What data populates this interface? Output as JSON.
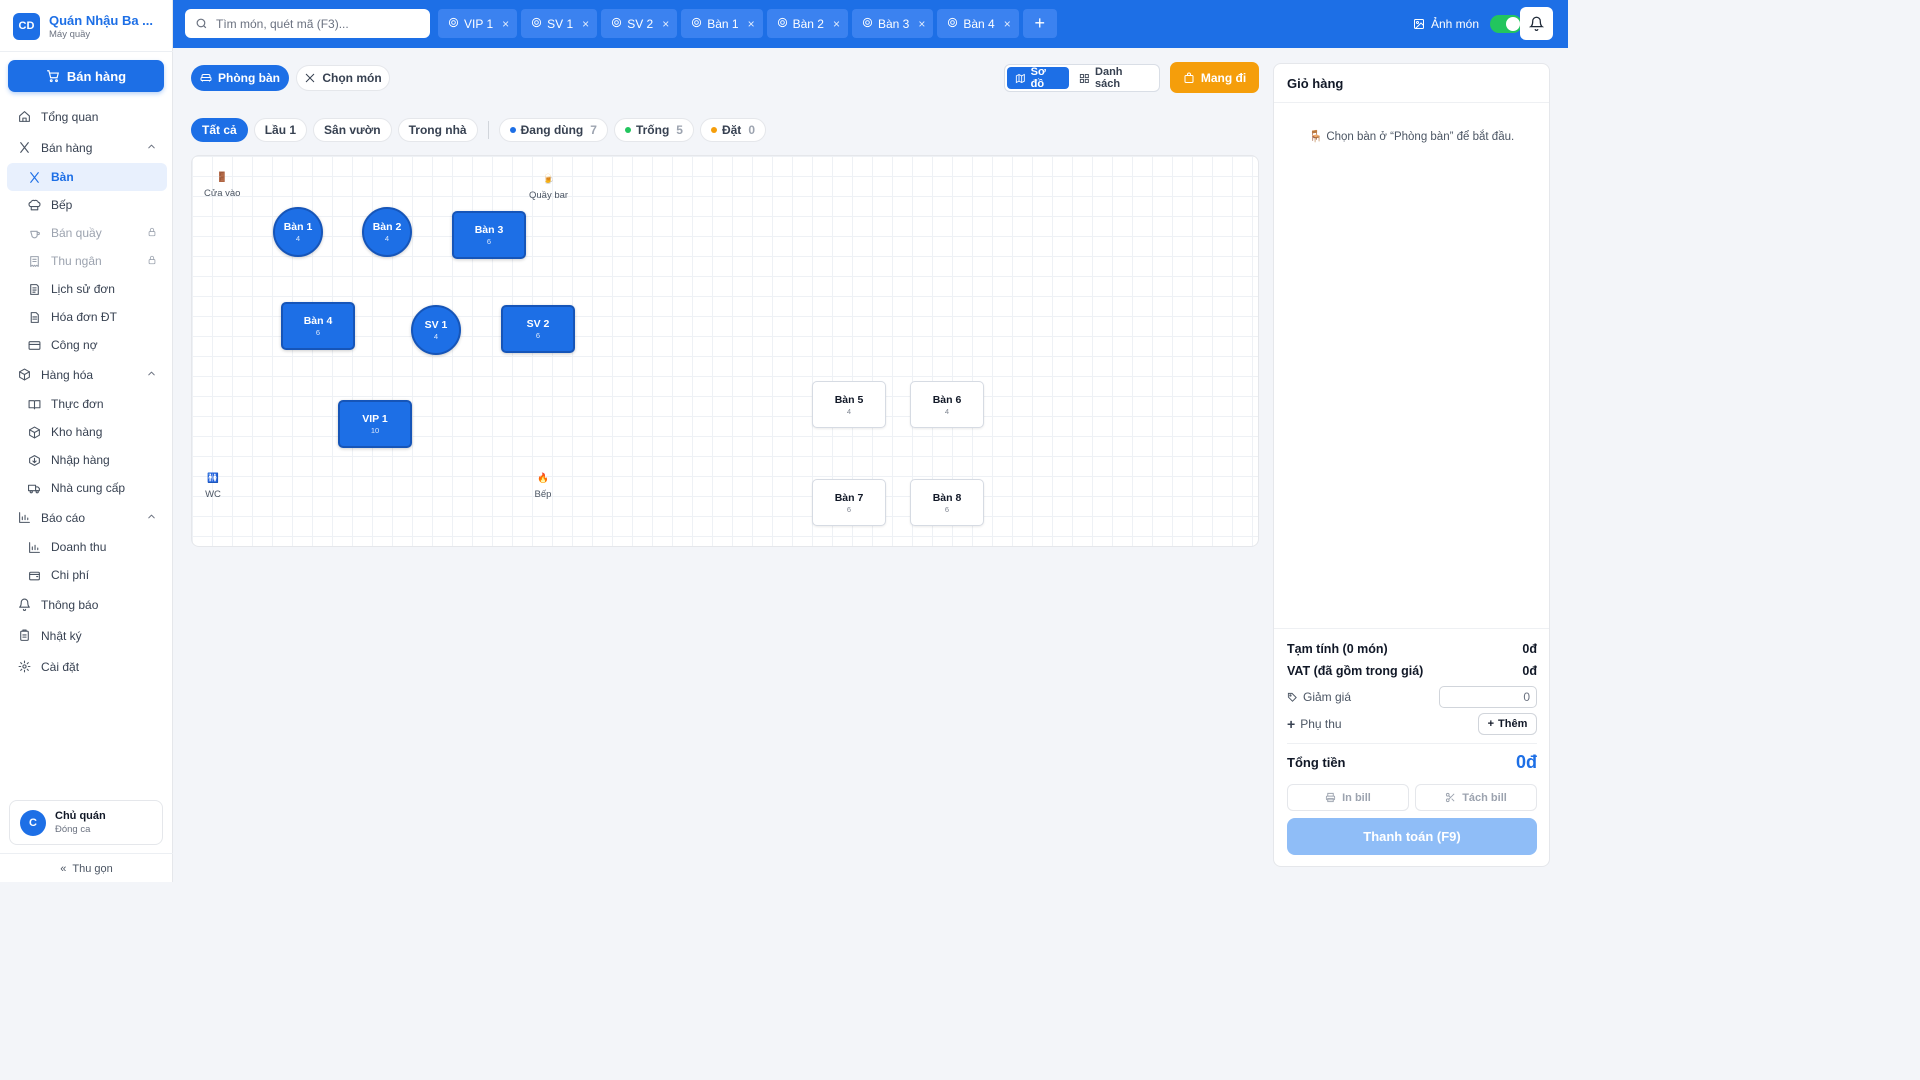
{
  "brand": {
    "logo": "CD",
    "name": "Quán Nhậu Ba ...",
    "subtitle": "Máy quầy"
  },
  "sidebar": {
    "primary_button": "Bán hàng",
    "items": [
      {
        "label": "Tổng quan",
        "icon": "home-icon",
        "level": "top"
      },
      {
        "label": "Bán hàng",
        "icon": "utensils-icon",
        "level": "top",
        "expanded": true
      },
      {
        "label": "Bàn",
        "icon": "utensils-icon",
        "level": "sub",
        "active": true
      },
      {
        "label": "Bếp",
        "icon": "chef-hat-icon",
        "level": "sub"
      },
      {
        "label": "Bán quầy",
        "icon": "cup-icon",
        "level": "sub",
        "locked": true
      },
      {
        "label": "Thu ngân",
        "icon": "receipt-icon",
        "level": "sub",
        "locked": true
      },
      {
        "label": "Lịch sử đơn",
        "icon": "history-icon",
        "level": "sub"
      },
      {
        "label": "Hóa đơn ĐT",
        "icon": "invoice-icon",
        "level": "sub"
      },
      {
        "label": "Công nợ",
        "icon": "card-icon",
        "level": "sub"
      },
      {
        "label": "Hàng hóa",
        "icon": "box-icon",
        "level": "top",
        "expanded": true
      },
      {
        "label": "Thực đơn",
        "icon": "book-icon",
        "level": "sub"
      },
      {
        "label": "Kho hàng",
        "icon": "box-icon",
        "level": "sub"
      },
      {
        "label": "Nhập hàng",
        "icon": "box-in-icon",
        "level": "sub"
      },
      {
        "label": "Nhà cung cấp",
        "icon": "truck-icon",
        "level": "sub"
      },
      {
        "label": "Báo cáo",
        "icon": "chart-icon",
        "level": "top",
        "expanded": true
      },
      {
        "label": "Doanh thu",
        "icon": "chart-icon",
        "level": "sub"
      },
      {
        "label": "Chi phí",
        "icon": "wallet-icon",
        "level": "sub"
      },
      {
        "label": "Thông báo",
        "icon": "bell-icon",
        "level": "top"
      },
      {
        "label": "Nhật ký",
        "icon": "clipboard-icon",
        "level": "top"
      },
      {
        "label": "Cài đặt",
        "icon": "gear-icon",
        "level": "top"
      }
    ],
    "user": {
      "initial": "C",
      "name": "Chủ quán",
      "status": "Đóng ca"
    },
    "collapse_label": "Thu gọn"
  },
  "topbar": {
    "search_placeholder": "Tìm món, quét mã (F3)...",
    "tabs": [
      "VIP 1",
      "SV 1",
      "SV 2",
      "Bàn 1",
      "Bàn 2",
      "Bàn 3",
      "Bàn 4"
    ],
    "photo_toggle_label": "Ảnh món",
    "photo_toggle_on": true
  },
  "main": {
    "mode_rooms": "Phòng bàn",
    "mode_menu": "Chọn món",
    "view_map": "Sơ đồ",
    "view_list": "Danh sách",
    "takeaway": "Mang đi",
    "area_filters": [
      "Tất cả",
      "Lầu 1",
      "Sân vườn",
      "Trong nhà"
    ],
    "status_filters": [
      {
        "label": "Đang dùng",
        "count": "7",
        "color": "#1d6fe6"
      },
      {
        "label": "Trống",
        "count": "5",
        "color": "#22c55e"
      },
      {
        "label": "Đặt",
        "count": "0",
        "color": "#f59e0b"
      }
    ]
  },
  "floor": {
    "landmarks": [
      {
        "label": "Cửa vào",
        "icon": "door-icon"
      },
      {
        "label": "Quầy bar",
        "icon": "beer-icon"
      },
      {
        "label": "WC",
        "icon": "restroom-icon"
      },
      {
        "label": "Bếp",
        "icon": "fire-icon"
      }
    ],
    "tables": [
      {
        "name": "Bàn 1",
        "seats": "4",
        "status": "busy",
        "shape": "round"
      },
      {
        "name": "Bàn 2",
        "seats": "4",
        "status": "busy",
        "shape": "round"
      },
      {
        "name": "Bàn 3",
        "seats": "6",
        "status": "busy",
        "shape": "rect"
      },
      {
        "name": "Bàn 4",
        "seats": "6",
        "status": "busy",
        "shape": "rect"
      },
      {
        "name": "SV 1",
        "seats": "4",
        "status": "busy",
        "shape": "round"
      },
      {
        "name": "SV 2",
        "seats": "6",
        "status": "busy",
        "shape": "rect"
      },
      {
        "name": "VIP 1",
        "seats": "10",
        "status": "busy",
        "shape": "rect"
      },
      {
        "name": "Bàn 5",
        "seats": "4",
        "status": "free",
        "shape": "rect"
      },
      {
        "name": "Bàn 6",
        "seats": "4",
        "status": "free",
        "shape": "rect"
      },
      {
        "name": "Bàn 7",
        "seats": "6",
        "status": "free",
        "shape": "rect"
      },
      {
        "name": "Bàn 8",
        "seats": "6",
        "status": "free",
        "shape": "rect"
      }
    ]
  },
  "cart": {
    "title": "Giỏ hàng",
    "hint": "Chọn bàn ở “Phòng bàn” để bắt đầu.",
    "subtotal_label": "Tạm tính (0 món)",
    "subtotal_value": "0đ",
    "vat_label": "VAT (đã gồm trong giá)",
    "vat_value": "0đ",
    "discount_label": "Giảm giá",
    "discount_value": "0",
    "surcharge_label": "Phụ thu",
    "add_label": "Thêm",
    "total_label": "Tổng tiền",
    "total_value": "0đ",
    "print_bill": "In bill",
    "split_bill": "Tách bill",
    "pay_button": "Thanh toán (F9)"
  },
  "colors": {
    "primary": "#1d6fe6",
    "busy": "#1d6fe6",
    "free": "#22c55e",
    "reserved": "#f59e0b",
    "takeaway": "#f59e0b"
  }
}
